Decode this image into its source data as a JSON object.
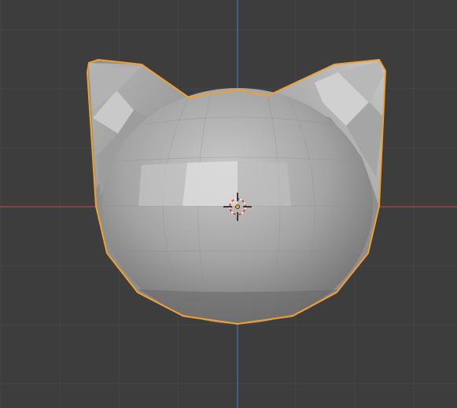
{
  "viewport": {
    "background_color": "#3d3d3d",
    "grid_color": "#444444",
    "x_axis_color": "#b04545",
    "y_axis_color": "#4a74b0",
    "selection_outline_color": "#f0a030",
    "cursor_icon": "3d-cursor-icon",
    "object": {
      "type": "mesh",
      "shape": "low-poly cat head",
      "selected": true,
      "shading": "solid"
    }
  }
}
